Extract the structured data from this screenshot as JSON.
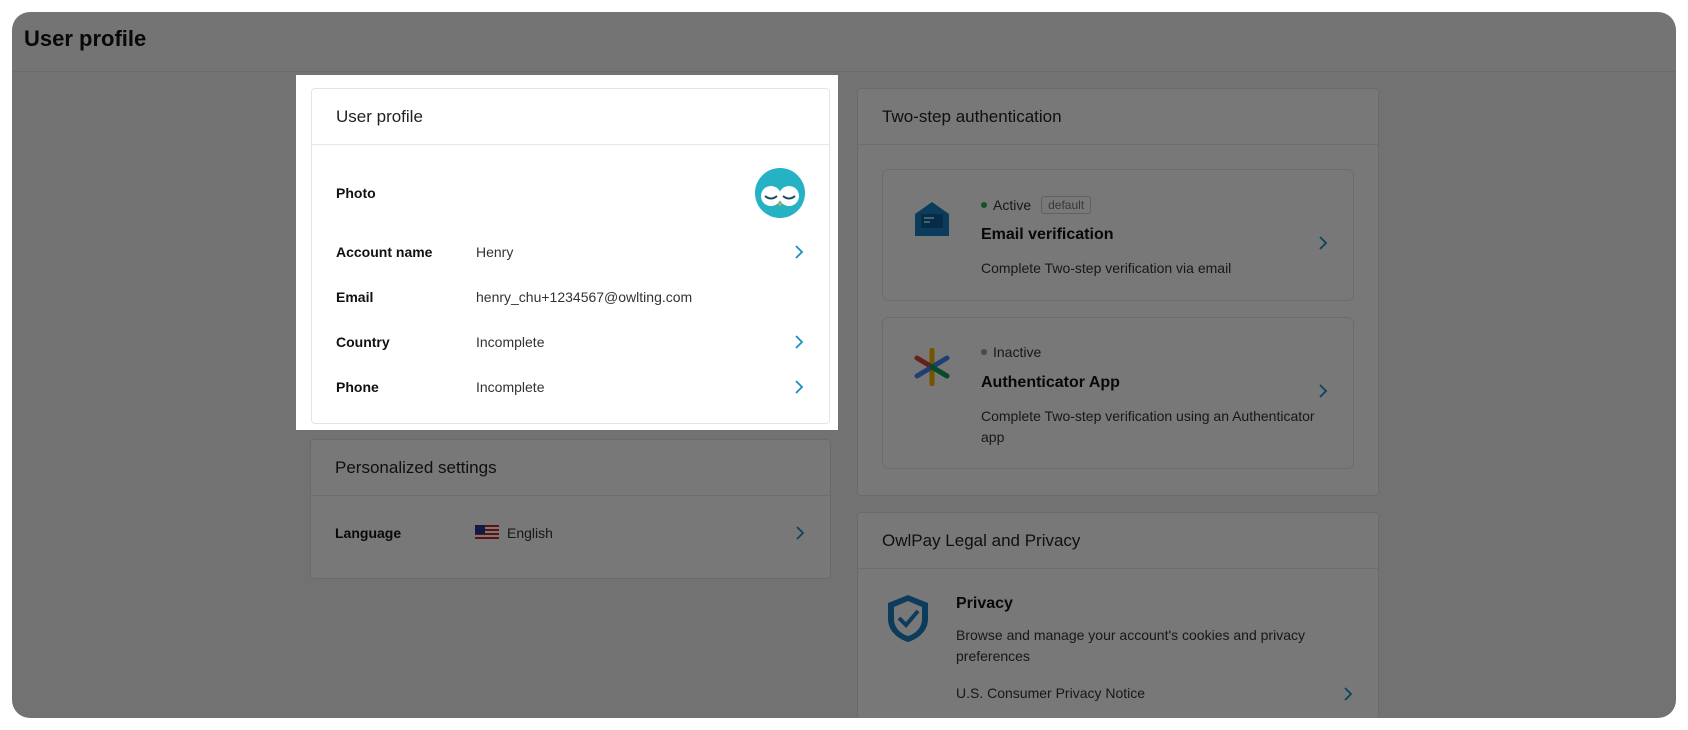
{
  "app": {
    "title": "User profile"
  },
  "profile": {
    "title": "User profile",
    "rows": [
      {
        "label": "Photo",
        "value": ""
      },
      {
        "label": "Account name",
        "value": "Henry"
      },
      {
        "label": "Email",
        "value": "henry_chu+1234567@owlting.com"
      },
      {
        "label": "Country",
        "value": "Incomplete"
      },
      {
        "label": "Phone",
        "value": "Incomplete"
      }
    ]
  },
  "settings": {
    "title": "Personalized settings",
    "language_label": "Language",
    "language_value": "English",
    "flag_icon": "us-flag-icon"
  },
  "two_step": {
    "title": "Two-step authentication",
    "methods": [
      {
        "status": "Active",
        "status_color": "#2bb24c",
        "tag": "default",
        "name": "Email verification",
        "desc": "Complete Two-step verification via email"
      },
      {
        "status": "Inactive",
        "status_color": "#9e9e9e",
        "tag": "",
        "name": "Authenticator App",
        "desc": "Complete Two-step verification using an Authenticator app"
      }
    ]
  },
  "legal": {
    "title": "OwlPay Legal and Privacy",
    "privacy_title": "Privacy",
    "privacy_desc": "Browse and manage your account's cookies and privacy preferences",
    "link": "U.S. Consumer Privacy Notice"
  },
  "colors": {
    "accent": "#1a8fc4",
    "overlay": "rgba(0,0,0,0.53)"
  }
}
